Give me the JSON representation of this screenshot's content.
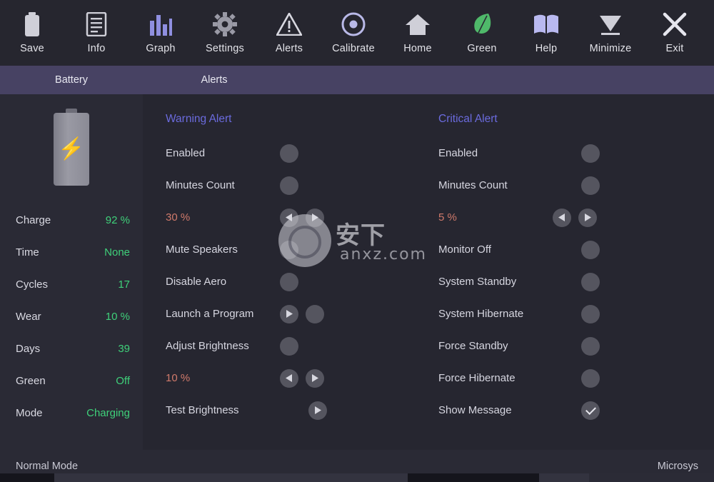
{
  "toolbar": {
    "items": [
      {
        "label": "Save",
        "icon": "save-battery-icon",
        "color": "#cfcfd8"
      },
      {
        "label": "Info",
        "icon": "info-document-icon",
        "color": "#cfcfd8"
      },
      {
        "label": "Graph",
        "icon": "bar-chart-icon",
        "color": "#8f8fe0"
      },
      {
        "label": "Settings",
        "icon": "gear-icon",
        "color": "#9a9aa6"
      },
      {
        "label": "Alerts",
        "icon": "warning-triangle-icon",
        "color": "#d8d8e0"
      },
      {
        "label": "Calibrate",
        "icon": "target-circle-icon",
        "color": "#b9b9e8"
      },
      {
        "label": "Home",
        "icon": "home-icon",
        "color": "#cfcfd8"
      },
      {
        "label": "Green",
        "icon": "leaf-icon",
        "color": "#4fb96a"
      },
      {
        "label": "Help",
        "icon": "book-icon",
        "color": "#b9b9f0"
      },
      {
        "label": "Minimize",
        "icon": "minimize-chevron-icon",
        "color": "#cfcfd8"
      },
      {
        "label": "Exit",
        "icon": "close-x-icon",
        "color": "#e6e6ee"
      }
    ]
  },
  "tabs": [
    {
      "label": "Battery",
      "active": false
    },
    {
      "label": "Alerts",
      "active": true
    }
  ],
  "sidebar": {
    "battery": {
      "icon": "battery-charging-icon"
    },
    "stats": [
      {
        "label": "Charge",
        "value": "92 %",
        "color": "#3fd07a"
      },
      {
        "label": "Time",
        "value": "None",
        "color": "#3fd07a"
      },
      {
        "label": "Cycles",
        "value": "17",
        "color": "#3fd07a"
      },
      {
        "label": "Wear",
        "value": "10 %",
        "color": "#3fd07a"
      },
      {
        "label": "Days",
        "value": "39",
        "color": "#3fd07a"
      },
      {
        "label": "Green",
        "value": "Off",
        "color": "#3fd07a"
      },
      {
        "label": "Mode",
        "value": "Charging",
        "color": "#3fd07a"
      }
    ]
  },
  "warning": {
    "title": "Warning Alert",
    "rows": [
      {
        "label": "Enabled",
        "type": "toggle",
        "checked": false,
        "arrows": "none"
      },
      {
        "label": "Minutes Count",
        "type": "toggle",
        "checked": false,
        "arrows": "none"
      },
      {
        "label": "30 %",
        "type": "percent",
        "checked": false,
        "arrows": "both"
      },
      {
        "label": "Mute Speakers",
        "type": "toggle",
        "checked": false,
        "arrows": "none"
      },
      {
        "label": "Disable Aero",
        "type": "toggle",
        "checked": false,
        "arrows": "none"
      },
      {
        "label": "Launch a Program",
        "type": "toggle",
        "checked": false,
        "arrows": "right"
      },
      {
        "label": "Adjust Brightness",
        "type": "toggle",
        "checked": false,
        "arrows": "none"
      },
      {
        "label": "10 %",
        "type": "percent",
        "checked": false,
        "arrows": "both"
      },
      {
        "label": "Test Brightness",
        "type": "action",
        "checked": false,
        "arrows": "only-right"
      }
    ]
  },
  "critical": {
    "title": "Critical Alert",
    "rows": [
      {
        "label": "Enabled",
        "type": "toggle",
        "checked": false,
        "arrows": "none"
      },
      {
        "label": "Minutes Count",
        "type": "toggle",
        "checked": false,
        "arrows": "none"
      },
      {
        "label": "5 %",
        "type": "percent",
        "checked": false,
        "arrows": "both-right"
      },
      {
        "label": "Monitor Off",
        "type": "toggle",
        "checked": false,
        "arrows": "none"
      },
      {
        "label": "System Standby",
        "type": "toggle",
        "checked": false,
        "arrows": "none"
      },
      {
        "label": "System Hibernate",
        "type": "toggle",
        "checked": false,
        "arrows": "none"
      },
      {
        "label": "Force Standby",
        "type": "toggle",
        "checked": false,
        "arrows": "none"
      },
      {
        "label": "Force Hibernate",
        "type": "toggle",
        "checked": false,
        "arrows": "none"
      },
      {
        "label": "Show Message",
        "type": "toggle",
        "checked": true,
        "arrows": "none"
      }
    ]
  },
  "statusbar": {
    "left": "Normal Mode",
    "right": "Microsys"
  },
  "watermark": {
    "text": "安下",
    "sub": "anxz.com"
  }
}
